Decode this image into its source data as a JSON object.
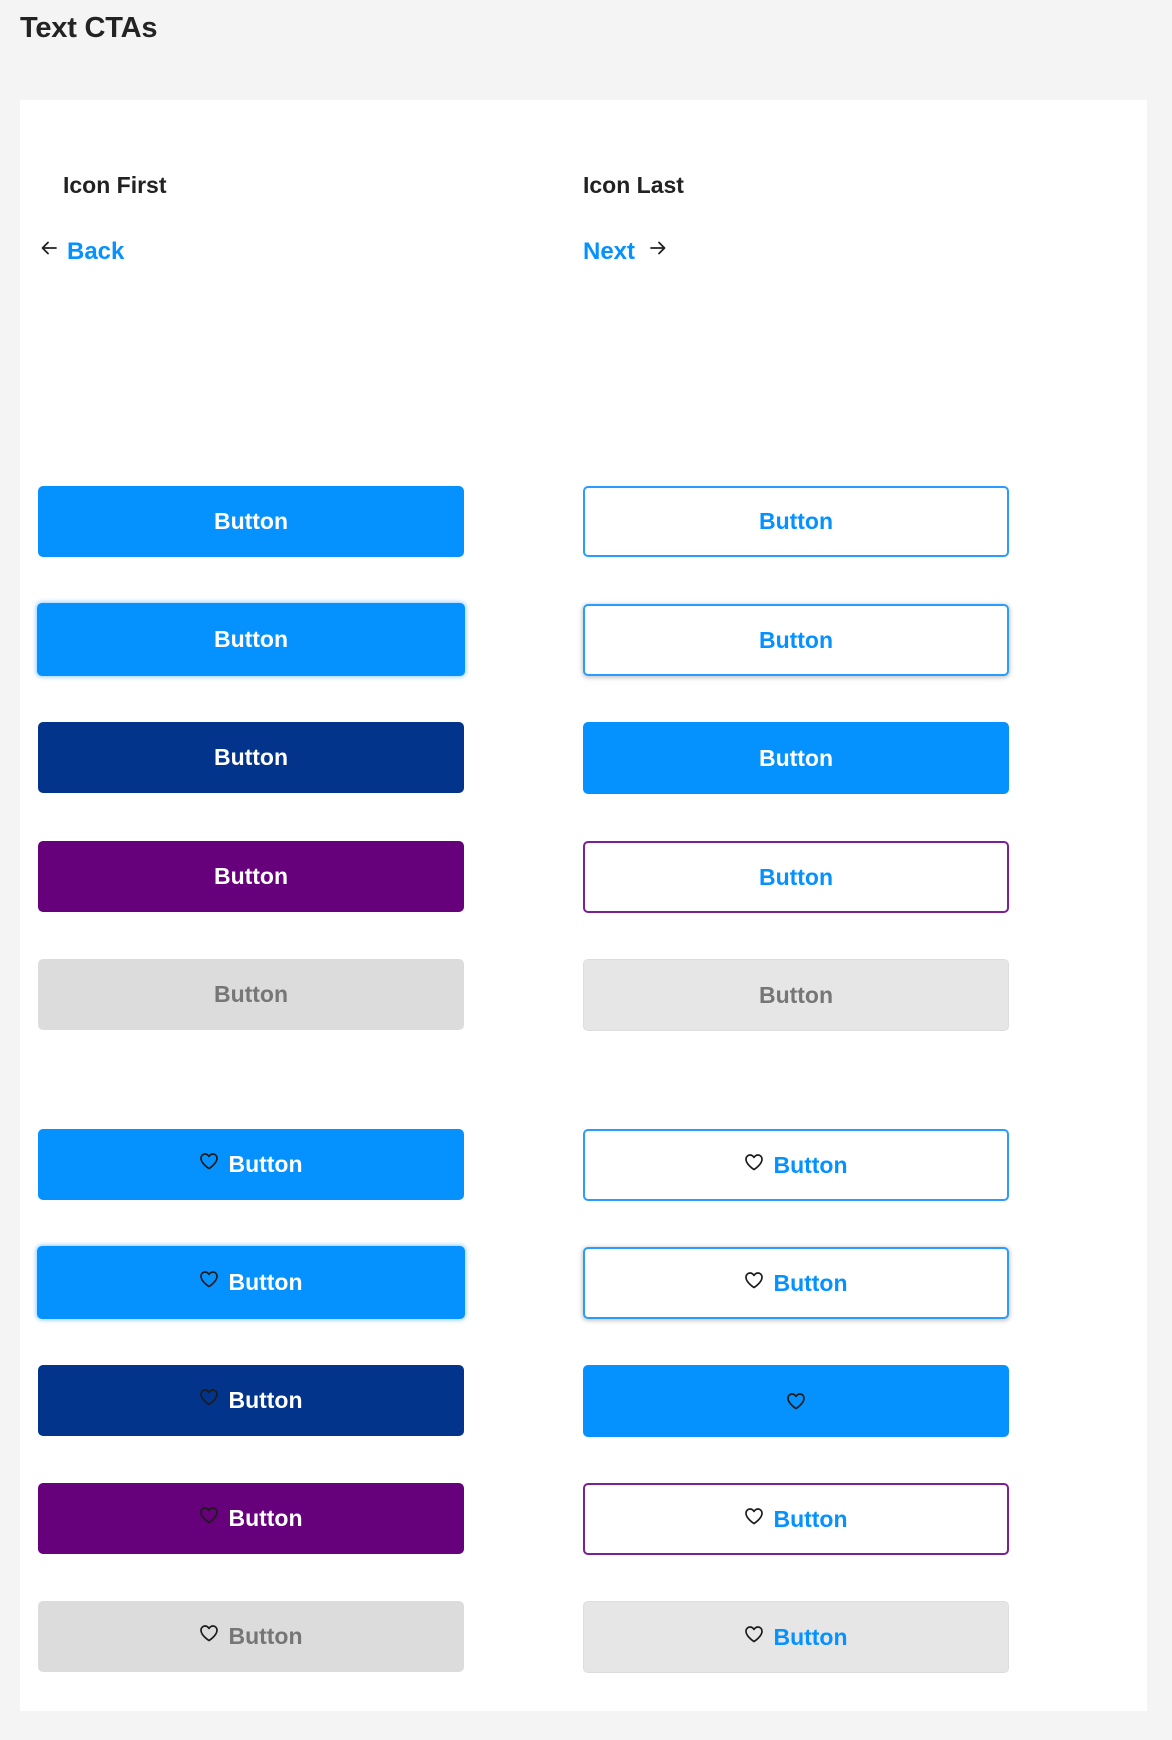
{
  "page": {
    "title": "Text CTAs"
  },
  "columns": {
    "left_heading": "Icon First",
    "right_heading": "Icon Last"
  },
  "text_ctas": {
    "back": {
      "label": "Back",
      "icon": "arrow-left-icon"
    },
    "next": {
      "label": "Next",
      "icon": "arrow-right-icon"
    }
  },
  "colors": {
    "primary_blue": "#0592ff",
    "navy": "#02348c",
    "purple": "#66007b",
    "disabled_bg": "#dcdcdc",
    "disabled_text": "#767676",
    "page_bg": "#f4f4f4",
    "card_bg": "#ffffff"
  },
  "buttons": {
    "text_only": {
      "left": [
        {
          "label": "Button",
          "variant": "primary"
        },
        {
          "label": "Button",
          "variant": "primary-hover"
        },
        {
          "label": "Button",
          "variant": "navy"
        },
        {
          "label": "Button",
          "variant": "purple"
        },
        {
          "label": "Button",
          "variant": "disabled"
        }
      ],
      "right": [
        {
          "label": "Button",
          "variant": "outline"
        },
        {
          "label": "Button",
          "variant": "outline-hover"
        },
        {
          "label": "Button",
          "variant": "solid-blue"
        },
        {
          "label": "Button",
          "variant": "outline-purple"
        },
        {
          "label": "Button",
          "variant": "disabled"
        }
      ]
    },
    "with_icon": {
      "icon": "heart-icon",
      "left": [
        {
          "label": "Button",
          "variant": "primary"
        },
        {
          "label": "Button",
          "variant": "primary-hover"
        },
        {
          "label": "Button",
          "variant": "navy"
        },
        {
          "label": "Button",
          "variant": "purple"
        },
        {
          "label": "Button",
          "variant": "disabled"
        }
      ],
      "right": [
        {
          "label": "Button",
          "variant": "outline"
        },
        {
          "label": "Button",
          "variant": "outline-hover"
        },
        {
          "label": "",
          "variant": "solid-blue-icon-only"
        },
        {
          "label": "Button",
          "variant": "outline-purple"
        },
        {
          "label": "Button",
          "variant": "disabled"
        }
      ]
    }
  }
}
